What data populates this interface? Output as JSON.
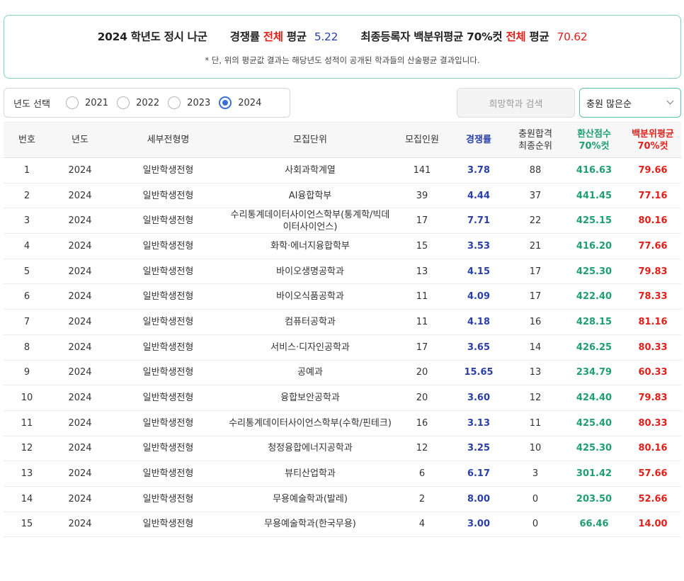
{
  "summary": {
    "title_prefix": "2024 학년도 정시 나군",
    "comp_label_a": "경쟁률",
    "comp_label_red": "전체",
    "comp_label_b": "평균",
    "comp_value": "5.22",
    "final_label_a": "최종등록자 백분위평균 70%컷",
    "final_label_red": "전체",
    "final_label_b": "평균",
    "final_value": "70.62",
    "note": "* 단, 위의 평균값 결과는 해당년도 성적이 공개된 학과들의 산술평균 결과입니다."
  },
  "filter": {
    "label": "년도 선택",
    "years": [
      "2021",
      "2022",
      "2023",
      "2024"
    ],
    "selected": "2024"
  },
  "search": {
    "label": "희망학과 검색"
  },
  "sort": {
    "value": "충원 많은순"
  },
  "table": {
    "headers": {
      "no": "번호",
      "year": "년도",
      "type": "세부전형명",
      "unit": "모집단위",
      "quota": "모집인원",
      "comp": "경쟁률",
      "fill_a": "충원합격",
      "fill_b": "최종순위",
      "score_a": "환산점수",
      "score_b": "70%컷",
      "pct_a": "백분위평균",
      "pct_b": "70%컷"
    },
    "rows": [
      {
        "no": "1",
        "year": "2024",
        "type": "일반학생전형",
        "unit": "사회과학계열",
        "quota": "141",
        "comp": "3.78",
        "fill": "88",
        "score": "416.63",
        "pct": "79.66"
      },
      {
        "no": "2",
        "year": "2024",
        "type": "일반학생전형",
        "unit": "AI융합학부",
        "quota": "39",
        "comp": "4.44",
        "fill": "37",
        "score": "441.45",
        "pct": "77.16"
      },
      {
        "no": "3",
        "year": "2024",
        "type": "일반학생전형",
        "unit": "수리통계데이터사이언스학부(통계학/빅데이터사이언스)",
        "quota": "17",
        "comp": "7.71",
        "fill": "22",
        "score": "425.15",
        "pct": "80.16"
      },
      {
        "no": "4",
        "year": "2024",
        "type": "일반학생전형",
        "unit": "화학·에너지융합학부",
        "quota": "15",
        "comp": "3.53",
        "fill": "21",
        "score": "416.20",
        "pct": "77.66"
      },
      {
        "no": "5",
        "year": "2024",
        "type": "일반학생전형",
        "unit": "바이오생명공학과",
        "quota": "13",
        "comp": "4.15",
        "fill": "17",
        "score": "425.30",
        "pct": "79.83"
      },
      {
        "no": "6",
        "year": "2024",
        "type": "일반학생전형",
        "unit": "바이오식품공학과",
        "quota": "11",
        "comp": "4.09",
        "fill": "17",
        "score": "422.40",
        "pct": "78.33"
      },
      {
        "no": "7",
        "year": "2024",
        "type": "일반학생전형",
        "unit": "컴퓨터공학과",
        "quota": "11",
        "comp": "4.18",
        "fill": "16",
        "score": "428.15",
        "pct": "81.16"
      },
      {
        "no": "8",
        "year": "2024",
        "type": "일반학생전형",
        "unit": "서비스·디자인공학과",
        "quota": "17",
        "comp": "3.65",
        "fill": "14",
        "score": "426.25",
        "pct": "80.33"
      },
      {
        "no": "9",
        "year": "2024",
        "type": "일반학생전형",
        "unit": "공예과",
        "quota": "20",
        "comp": "15.65",
        "fill": "13",
        "score": "234.79",
        "pct": "60.33"
      },
      {
        "no": "10",
        "year": "2024",
        "type": "일반학생전형",
        "unit": "융합보안공학과",
        "quota": "20",
        "comp": "3.60",
        "fill": "12",
        "score": "424.40",
        "pct": "79.83"
      },
      {
        "no": "11",
        "year": "2024",
        "type": "일반학생전형",
        "unit": "수리통계데이터사이언스학부(수학/핀테크)",
        "quota": "16",
        "comp": "3.13",
        "fill": "11",
        "score": "425.40",
        "pct": "80.33"
      },
      {
        "no": "12",
        "year": "2024",
        "type": "일반학생전형",
        "unit": "청정융합에너지공학과",
        "quota": "12",
        "comp": "3.25",
        "fill": "10",
        "score": "425.30",
        "pct": "80.16"
      },
      {
        "no": "13",
        "year": "2024",
        "type": "일반학생전형",
        "unit": "뷰티산업학과",
        "quota": "6",
        "comp": "6.17",
        "fill": "3",
        "score": "301.42",
        "pct": "57.66"
      },
      {
        "no": "14",
        "year": "2024",
        "type": "일반학생전형",
        "unit": "무용예술학과(발레)",
        "quota": "2",
        "comp": "8.00",
        "fill": "0",
        "score": "203.50",
        "pct": "52.66"
      },
      {
        "no": "15",
        "year": "2024",
        "type": "일반학생전형",
        "unit": "무용예술학과(한국무용)",
        "quota": "4",
        "comp": "3.00",
        "fill": "0",
        "score": "66.46",
        "pct": "14.00"
      }
    ]
  },
  "colors": {
    "accent_blue": "#2a3fa8",
    "accent_red": "#e0201b",
    "accent_teal": "#1f9e73",
    "border_green": "#7fd3b8"
  }
}
